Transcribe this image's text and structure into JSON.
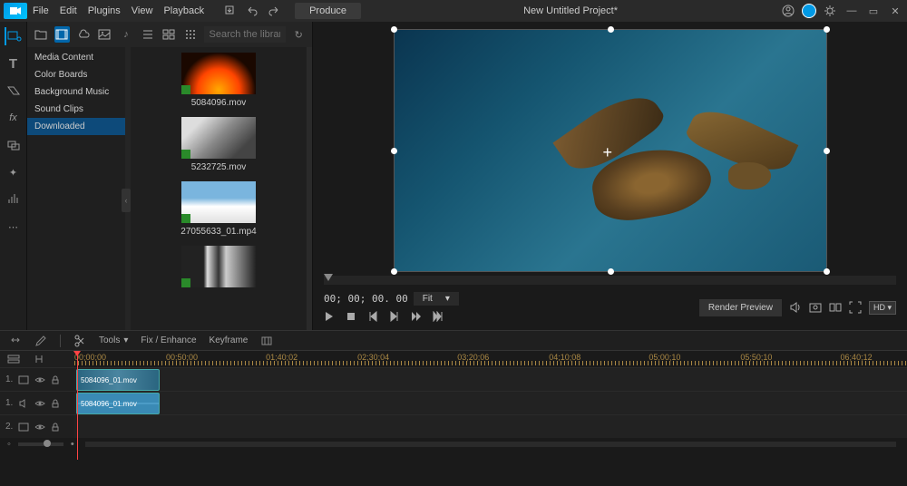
{
  "menu": {
    "file": "File",
    "edit": "Edit",
    "plugins": "Plugins",
    "view": "View",
    "playback": "Playback"
  },
  "topbar": {
    "produce": "Produce",
    "project_title": "New Untitled Project*"
  },
  "library": {
    "search_placeholder": "Search the library",
    "categories": {
      "media": "Media Content",
      "color": "Color Boards",
      "bgmusic": "Background Music",
      "sound": "Sound Clips",
      "downloaded": "Downloaded"
    },
    "items": [
      {
        "label": "5084096.mov"
      },
      {
        "label": "5232725.mov"
      },
      {
        "label": "27055633_01.mp4"
      },
      {
        "label": ""
      }
    ]
  },
  "preview": {
    "timecode": "00; 00; 00. 00",
    "fit_label": "Fit",
    "render_preview": "Render Preview",
    "quality": "HD"
  },
  "timeline_tools": {
    "tools": "Tools",
    "fix": "Fix / Enhance",
    "keyframe": "Keyframe"
  },
  "ruler": [
    "00;00;00",
    "00;50;00",
    "01;40;02",
    "02;30;04",
    "03;20;06",
    "04;10;08",
    "05;00;10",
    "05;50;10",
    "06;40;12"
  ],
  "tracks": {
    "t1": "1.",
    "t1a": "1.",
    "t2": "2.",
    "clip_video_label": "5084096_01.mov",
    "clip_audio_label": "5084096_01.mov"
  }
}
